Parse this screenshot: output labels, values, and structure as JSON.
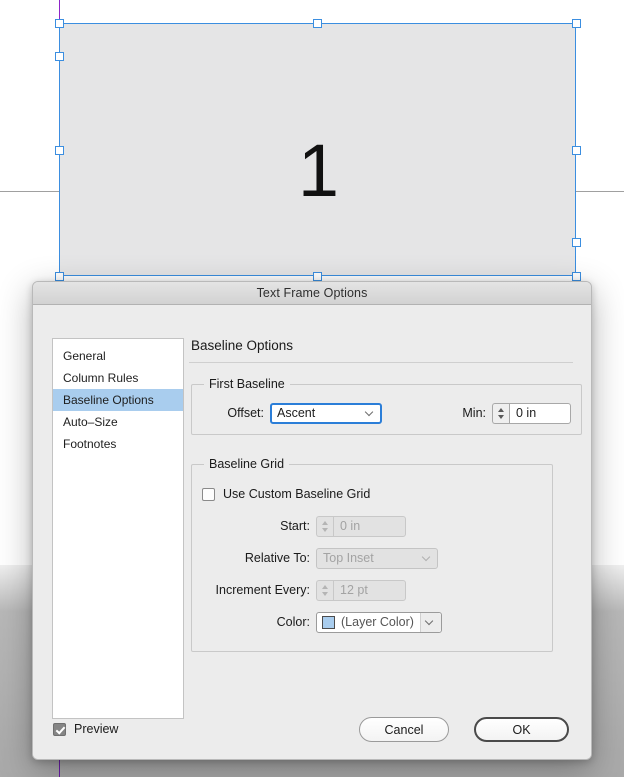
{
  "canvas": {
    "frame_text": "1",
    "frame_label": "text-frame",
    "guide_color": "#8e24c8",
    "selection_color": "#3b8ee0"
  },
  "dialog": {
    "title": "Text Frame Options",
    "sidebar": {
      "items": [
        {
          "label": "General",
          "selected": false
        },
        {
          "label": "Column Rules",
          "selected": false
        },
        {
          "label": "Baseline Options",
          "selected": true
        },
        {
          "label": "Auto–Size",
          "selected": false
        },
        {
          "label": "Footnotes",
          "selected": false
        }
      ]
    },
    "pane": {
      "title": "Baseline Options",
      "first_baseline": {
        "legend": "First Baseline",
        "offset_label": "Offset:",
        "offset_value": "Ascent",
        "min_label": "Min:",
        "min_value": "0 in"
      },
      "baseline_grid": {
        "legend": "Baseline Grid",
        "use_custom_label": "Use Custom Baseline Grid",
        "use_custom_checked": false,
        "start_label": "Start:",
        "start_value": "0 in",
        "relative_label": "Relative To:",
        "relative_value": "Top Inset",
        "increment_label": "Increment Every:",
        "increment_value": "12 pt",
        "color_label": "Color:",
        "color_value": "(Layer Color)",
        "color_swatch": "#a9cdee"
      }
    },
    "footer": {
      "preview_label": "Preview",
      "preview_checked": true,
      "cancel_label": "Cancel",
      "ok_label": "OK"
    }
  }
}
